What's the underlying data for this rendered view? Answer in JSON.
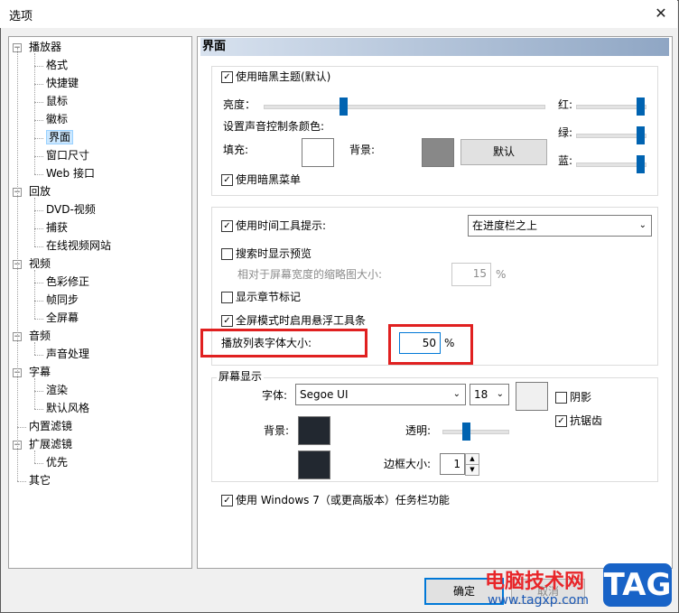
{
  "window": {
    "title": "选项",
    "close_icon": "close-icon"
  },
  "tree": {
    "items": [
      {
        "label": "播放器",
        "expander": "−"
      },
      {
        "label": "格式"
      },
      {
        "label": "快捷键"
      },
      {
        "label": "鼠标"
      },
      {
        "label": "徽标"
      },
      {
        "label": "界面",
        "selected": true
      },
      {
        "label": "窗口尺寸"
      },
      {
        "label": "Web 接口"
      },
      {
        "label": "回放",
        "expander": "−"
      },
      {
        "label": "DVD-视频"
      },
      {
        "label": "捕获"
      },
      {
        "label": "在线视频网站"
      },
      {
        "label": "视频",
        "expander": "−"
      },
      {
        "label": "色彩修正"
      },
      {
        "label": "帧同步"
      },
      {
        "label": "全屏幕"
      },
      {
        "label": "音频",
        "expander": "−"
      },
      {
        "label": "声音处理"
      },
      {
        "label": "字幕",
        "expander": "−"
      },
      {
        "label": "渲染"
      },
      {
        "label": "默认风格"
      },
      {
        "label": "内置滤镜"
      },
      {
        "label": "扩展滤镜",
        "expander": "−"
      },
      {
        "label": "优先"
      },
      {
        "label": "其它"
      }
    ]
  },
  "panel": {
    "header": "界面",
    "dark_theme": {
      "label": "使用暗黑主题(默认)",
      "checked": true
    },
    "brightness_label": "亮度：",
    "brightness_level": 0.28,
    "red_label": "红:",
    "green_label": "绿:",
    "blue_label": "蓝:",
    "red_level": 1.0,
    "green_level": 1.0,
    "blue_level": 1.0,
    "volume_color_label": "设置声音控制条颜色:",
    "fill_label": "填充:",
    "background_label": "背景:",
    "default_button": "默认",
    "dark_menu": {
      "label": "使用暗黑菜单",
      "checked": true
    },
    "time_tooltip": {
      "label": "使用时间工具提示:",
      "checked": true
    },
    "tooltip_position": "在进度栏之上",
    "preview_on_seek": {
      "label": "搜索时显示预览",
      "checked": false
    },
    "thumb_size_label": "相对于屏幕宽度的缩略图大小:",
    "thumb_size_value": "15",
    "thumb_size_unit": "%",
    "chapter_marks": {
      "label": "显示章节标记",
      "checked": false
    },
    "floating_toolbar": {
      "label": "全屏模式时启用悬浮工具条",
      "checked": true
    },
    "playlist_font_label": "播放列表字体大小:",
    "playlist_font_value": "50",
    "playlist_font_unit": "%",
    "osd_group": "屏幕显示",
    "font_label": "字体:",
    "font_value": "Segoe UI",
    "font_size_value": "18",
    "shadow": {
      "label": "阴影",
      "checked": false
    },
    "antialias": {
      "label": "抗锯齿",
      "checked": true
    },
    "osd_bg_label": "背景:",
    "transparency_label": "透明:",
    "transparency_level": 0.1,
    "border_label": "边框大小:",
    "border_value": "1",
    "win7_taskbar": {
      "label": "使用 Windows 7（或更高版本）任务栏功能",
      "checked": true
    }
  },
  "buttons": {
    "ok": "确定",
    "cancel": "取消"
  },
  "watermark": {
    "text1": "电脑技术网",
    "text2": "www.tagxp.com",
    "badge": "TAG"
  },
  "colors": {
    "accent": "#0063b1",
    "highlight_red": "#e02020",
    "fill_swatch": "#ffffff",
    "bg_swatch": "#888888",
    "osd_swatch": "#222830",
    "header_gradient_end": "#8fa6c4"
  }
}
